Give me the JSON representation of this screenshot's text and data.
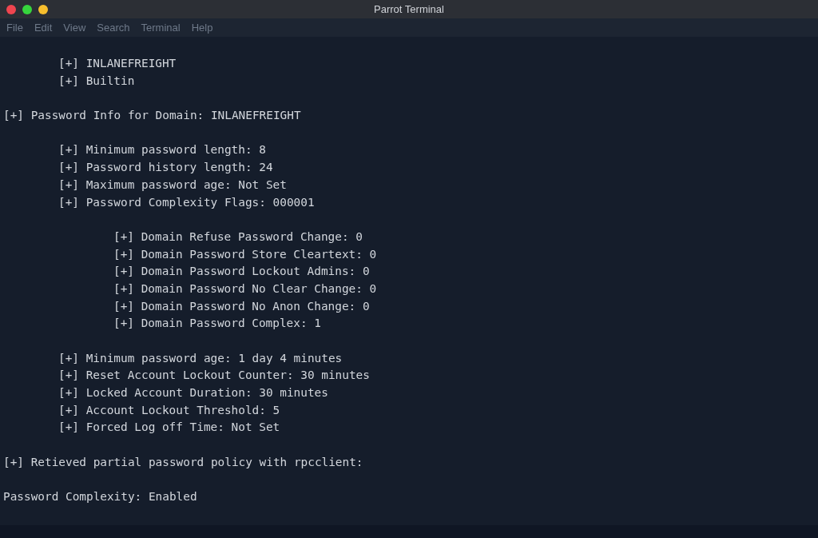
{
  "window": {
    "title": "Parrot Terminal"
  },
  "menu": [
    "File",
    "Edit",
    "View",
    "Search",
    "Terminal",
    "Help"
  ],
  "output": [
    {
      "children": [
        {
          "text": "[+] INLANEFREIGHT"
        },
        {
          "text": "[+] Builtin"
        }
      ]
    },
    {
      "text": "[+] Password Info for Domain: INLANEFREIGHT",
      "children": [
        {
          "text": "[+] Minimum password length: 8"
        },
        {
          "text": "[+] Password history length: 24"
        },
        {
          "text": "[+] Maximum password age: Not Set"
        },
        {
          "text": "[+] Password Complexity Flags: 000001",
          "children": [
            {
              "text": "[+] Domain Refuse Password Change: 0"
            },
            {
              "text": "[+] Domain Password Store Cleartext: 0"
            },
            {
              "text": "[+] Domain Password Lockout Admins: 0"
            },
            {
              "text": "[+] Domain Password No Clear Change: 0"
            },
            {
              "text": "[+] Domain Password No Anon Change: 0"
            },
            {
              "text": "[+] Domain Password Complex: 1"
            }
          ]
        },
        {
          "text": "[+] Minimum password age: 1 day 4 minutes"
        },
        {
          "text": "[+] Reset Account Lockout Counter: 30 minutes"
        },
        {
          "text": "[+] Locked Account Duration: 30 minutes"
        },
        {
          "text": "[+] Account Lockout Threshold: 5"
        },
        {
          "text": "[+] Forced Log off Time: Not Set"
        }
      ]
    },
    {
      "text": "[+] Retieved partial password policy with rpcclient:"
    },
    {
      "text": "Password Complexity: Enabled"
    }
  ]
}
